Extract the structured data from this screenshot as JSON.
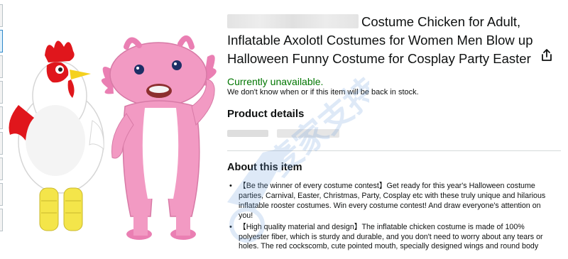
{
  "product": {
    "title": "Costume Chicken for Adult, Inflatable Axolotl Costumes for Women Men Blow up Halloween Funny Costume for Cosplay Party Easter",
    "availability": "Currently unavailable.",
    "stock_note": "We don't know when or if this item will be back in stock."
  },
  "details": {
    "heading": "Product details"
  },
  "about": {
    "heading": "About this item",
    "bullets": [
      "【Be the winner of every costume contest】Get ready for this year's Halloween costume parties, Carnival, Easter, Christmas, Party, Cosplay etc with these truly unique and hilarious inflatable rooster costumes. Win every costume contest! And draw everyone's attention on you!",
      "【High quality material and design】The inflatable chicken costume is made of 100% polyester fiber, which is sturdy and durable, and you don't need to worry about any tears or holes. The red cockscomb, cute pointed mouth, specially designed wings and round body"
    ]
  },
  "watermark": {
    "text": "麦家支持"
  },
  "colors": {
    "availability": "#007600",
    "rooster_body": "#ffffff",
    "rooster_comb": "#e0161c",
    "rooster_legs": "#f4e54a",
    "axolotl_body": "#f29ac3",
    "axolotl_belly": "#ffffff"
  },
  "icons": [
    "share-icon"
  ]
}
